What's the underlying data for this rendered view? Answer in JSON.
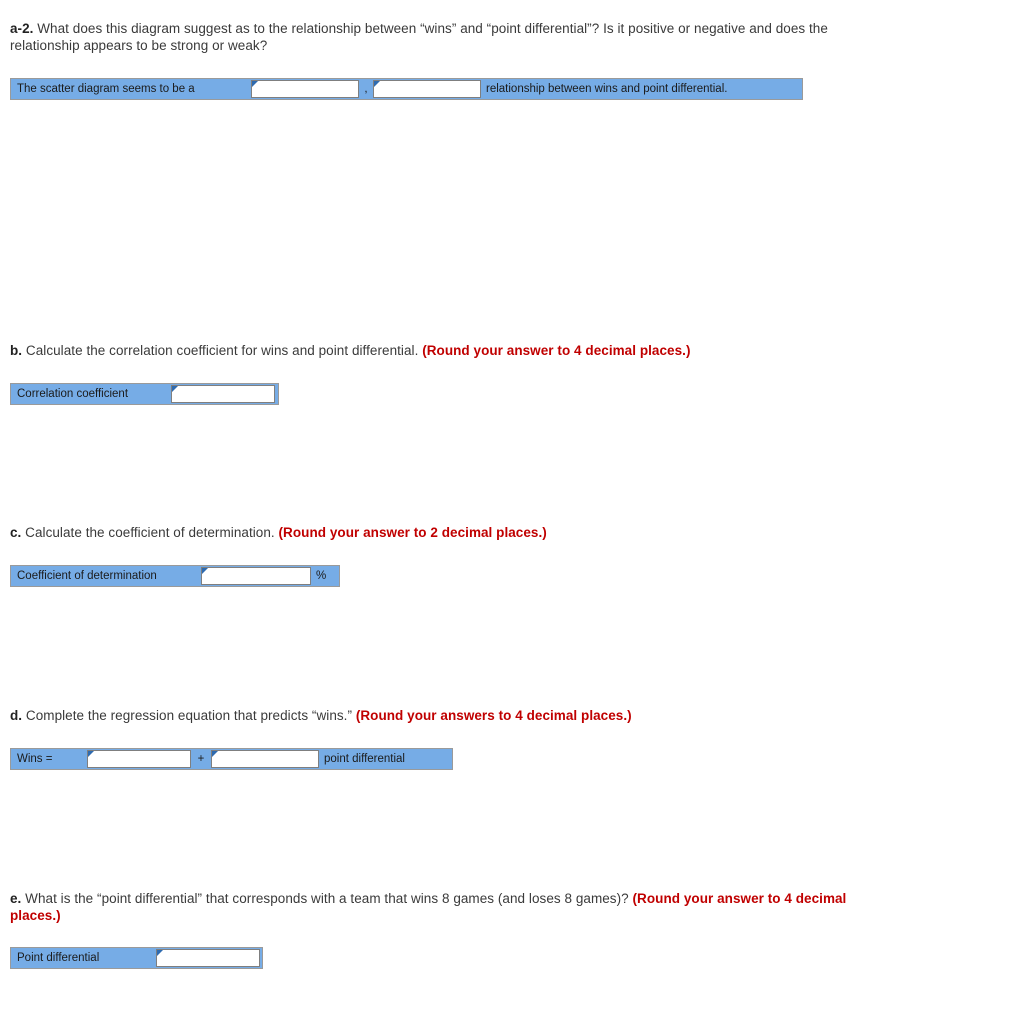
{
  "theme": {
    "bar_fill": "#76ACE6",
    "bar_border": "#9a9a9a",
    "field_bg": "#ffffff",
    "field_border": "#7f7f7f",
    "tab_marker": "#2e6bb0",
    "text": "#3a3a3a",
    "round_note": "#c00000"
  },
  "questions": {
    "a2": {
      "label": "a-2.",
      "text": " What does this diagram suggest as to the relationship between “wins” and “point differential”? Is it positive or negative and does the relationship appears to be strong or weak?",
      "row": {
        "lead_label": "The scatter diagram seems to be a",
        "input1_value": "",
        "separator": ",",
        "input2_value": "",
        "trailing_label": "relationship between wins and point differential."
      }
    },
    "b": {
      "label": "b.",
      "text": " Calculate the correlation coefficient for wins and point differential. ",
      "round_note": "(Round your answer to 4 decimal places.)",
      "row": {
        "lead_label": "Correlation coefficient",
        "input_value": ""
      }
    },
    "c": {
      "label": "c.",
      "text": " Calculate the coefficient of determination. ",
      "round_note": "(Round your answer to 2 decimal places.)",
      "row": {
        "lead_label": "Coefficient of determination",
        "input_value": "",
        "unit": "%"
      }
    },
    "d": {
      "label": "d.",
      "text": " Complete the regression equation that predicts “wins.” ",
      "round_note": "(Round your answers to 4 decimal places.)",
      "row": {
        "lead_label": "Wins =",
        "input1_value": "",
        "operator": "+",
        "input2_value": "",
        "trailing_label": "point differential"
      }
    },
    "e": {
      "label": "e.",
      "text": " What is the “point differential” that corresponds with a team that wins 8 games (and loses 8 games)? ",
      "round_note": "(Round your answer to 4 decimal places.)",
      "row": {
        "lead_label": "Point differential",
        "input_value": ""
      }
    }
  }
}
